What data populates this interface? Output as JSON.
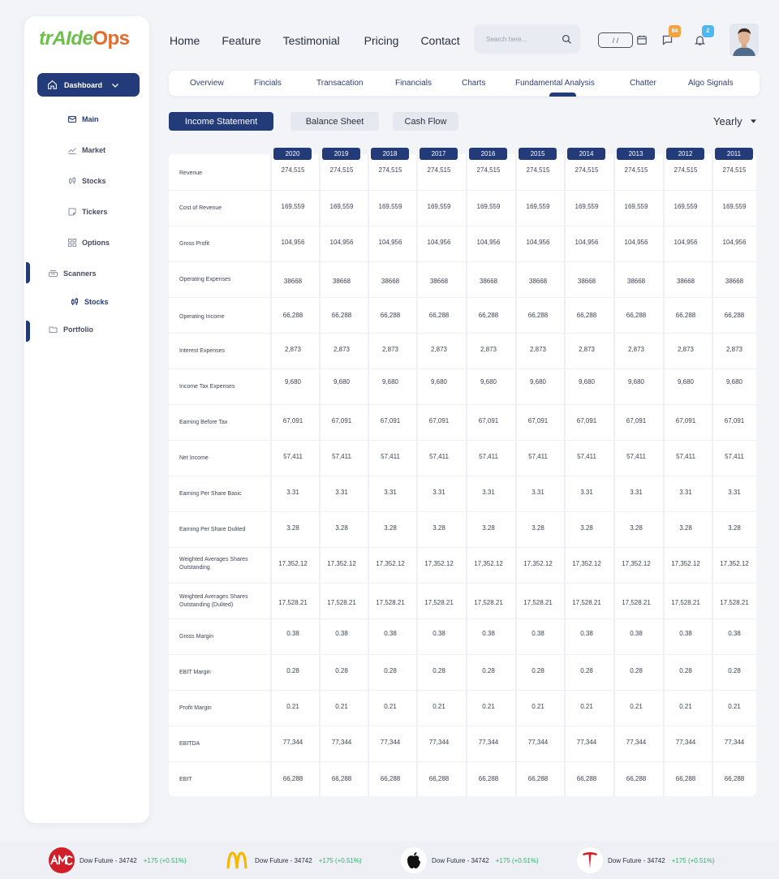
{
  "brand": {
    "part1": "trAIde",
    "part2": "Ops"
  },
  "sidebar": {
    "dashboard_label": "Dashboard",
    "items": [
      {
        "label": "Main"
      },
      {
        "label": "Market"
      },
      {
        "label": "Stocks"
      },
      {
        "label": "Tickers"
      },
      {
        "label": "Options"
      },
      {
        "label": "Scanners"
      },
      {
        "label": "Stocks"
      },
      {
        "label": "Portfolio"
      }
    ]
  },
  "header": {
    "nav": [
      "Home",
      "Feature",
      "Testimonial",
      "Pricing",
      "Contact"
    ],
    "search_placeholder": "Search here...",
    "date_value": "/   /",
    "chat_badge": "84",
    "bell_badge": "2"
  },
  "tabs": [
    "Overview",
    "Fincials",
    "Transacation",
    "Financials",
    "Charts",
    "Fundamental Analysis",
    "Chatter",
    "Algo Signals"
  ],
  "active_tab": "Fundamental Analysis",
  "statements": [
    "Income Statement",
    "Balance Sheet",
    "Cash Flow"
  ],
  "active_statement": "Income Statement",
  "period": "Yearly",
  "table": {
    "years": [
      "2020",
      "2019",
      "2018",
      "2017",
      "2016",
      "2015",
      "2014",
      "2013",
      "2012",
      "2011"
    ],
    "rows": [
      {
        "label": "Revenue",
        "value": "274,515"
      },
      {
        "label": "Cost of Revenue",
        "value": "169,559"
      },
      {
        "label": "Gross Profit",
        "value": "104,956"
      },
      {
        "label": "Operating Expenses",
        "value": "38668"
      },
      {
        "label": "Operating Income",
        "value": "66,288"
      },
      {
        "label": "Interest Expenses",
        "value": "2,873"
      },
      {
        "label": "Income Tax Expenses",
        "value": "9,680"
      },
      {
        "label": "Earning Before Tax",
        "value": "67,091"
      },
      {
        "label": "Net Income",
        "value": "57,411"
      },
      {
        "label": "Earning Per Share Basic",
        "value": "3.31"
      },
      {
        "label": "Earning Per Share Dulited",
        "value": "3.28"
      },
      {
        "label": "Weighted Averages Shares Outstanding",
        "value": "17,352.12"
      },
      {
        "label": "Weighted Averages Shares Outstanding (Dulited)",
        "value": "17,528.21"
      },
      {
        "label": "Gross Margin",
        "value": "0.38"
      },
      {
        "label": "EBIT Margin",
        "value": "0.28"
      },
      {
        "label": "Profit Margin",
        "value": "0.21"
      },
      {
        "label": "EBITDA",
        "value": "77,344"
      },
      {
        "label": "EBIT",
        "value": "66,288"
      }
    ]
  },
  "ticker": [
    {
      "icon": "amc-logo-icon",
      "text": "Dow Future - 34742",
      "change": "+175 (+0.51%)"
    },
    {
      "icon": "mcdonalds-logo-icon",
      "text": "Dow Future - 34742",
      "change": "+175 (+0.51%)"
    },
    {
      "icon": "apple-logo-icon",
      "text": "Dow Future - 34742",
      "change": "+175 (+0.51%)"
    },
    {
      "icon": "tesla-logo-icon",
      "text": "Dow Future - 34742",
      "change": "+175 (+0.51%)"
    }
  ],
  "colors": {
    "primary": "#243b7a",
    "positive": "#2fb36a",
    "badge_orange": "#f4a340",
    "badge_blue": "#4fb8ef"
  }
}
